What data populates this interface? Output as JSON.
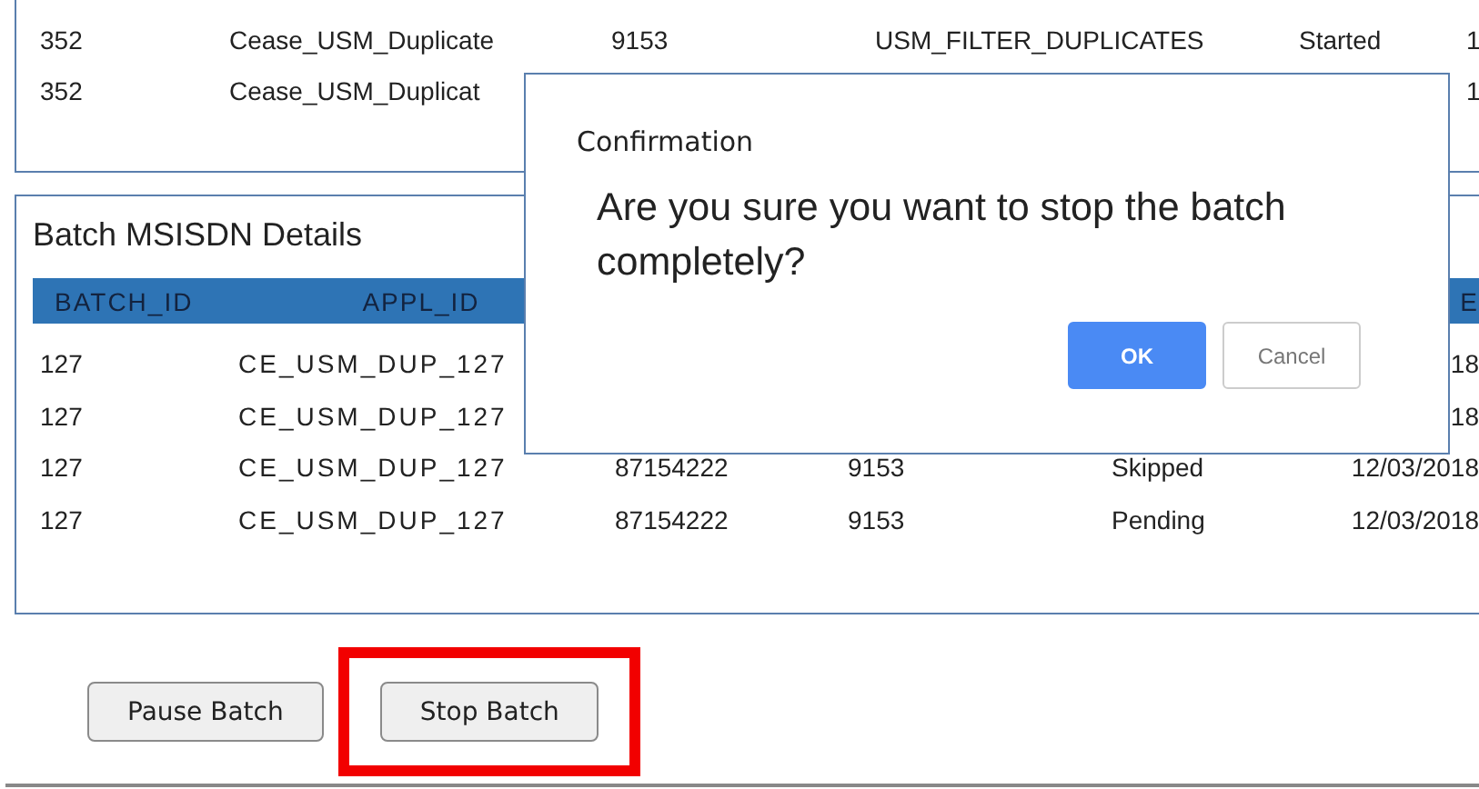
{
  "jobs_table": {
    "rows": [
      {
        "cells": [
          "352",
          "Cease_USM_Duplicate",
          "9153",
          "USM_FILTER_DUPLICATES",
          "Started",
          "1"
        ]
      },
      {
        "cells": [
          "352",
          "Cease_USM_Duplicat",
          "",
          "",
          "",
          "1"
        ]
      }
    ]
  },
  "msisdn_panel": {
    "title": "Batch MSISDN Details",
    "columns": [
      "BATCH_ID",
      "APPL_ID",
      "",
      "",
      "",
      "E"
    ],
    "rows": [
      {
        "cells": [
          "127",
          "CE_USM_DUP_127",
          "",
          "",
          "",
          "18"
        ]
      },
      {
        "cells": [
          "127",
          "CE_USM_DUP_127",
          "",
          "",
          "",
          "18"
        ]
      },
      {
        "cells": [
          "127",
          "CE_USM_DUP_127",
          "87154222",
          "9153",
          "Skipped",
          "12/03/2018"
        ]
      },
      {
        "cells": [
          "127",
          "CE_USM_DUP_127",
          "87154222",
          "9153",
          "Pending",
          "12/03/2018"
        ]
      }
    ]
  },
  "actions": [
    {
      "label": "Pause Batch",
      "highlighted": false
    },
    {
      "label": "Stop Batch",
      "highlighted": true
    }
  ],
  "dialog": {
    "title": "Confirmation",
    "message": "Are you sure you want to stop the batch completely?",
    "buttons": [
      {
        "label": "OK",
        "kind": "primary"
      },
      {
        "label": "Cancel",
        "kind": "secondary"
      }
    ]
  }
}
